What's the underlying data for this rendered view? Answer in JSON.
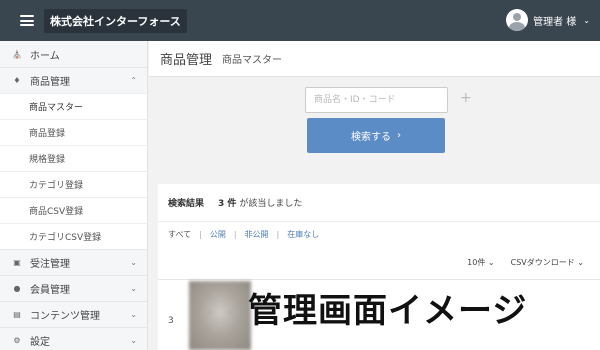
{
  "header": {
    "brand": "株式会社インターフォース",
    "user_label": "管理者 様"
  },
  "sidebar": {
    "items": [
      {
        "icon": "home-icon",
        "label": "ホーム"
      },
      {
        "icon": "tag-icon",
        "label": "商品管理",
        "expanded": true,
        "children": [
          "商品マスター",
          "商品登録",
          "規格登録",
          "カテゴリ登録",
          "商品CSV登録",
          "カテゴリCSV登録"
        ]
      },
      {
        "icon": "cart-icon",
        "label": "受注管理"
      },
      {
        "icon": "users-icon",
        "label": "会員管理"
      },
      {
        "icon": "document-icon",
        "label": "コンテンツ管理"
      },
      {
        "icon": "gear-icon",
        "label": "設定"
      }
    ]
  },
  "page": {
    "title": "商品管理",
    "subtitle": "商品マスター"
  },
  "search": {
    "placeholder": "商品名・ID・コード",
    "value": "",
    "button_label": "検索する"
  },
  "results": {
    "label": "検索結果",
    "count": "3 件",
    "message": "が該当しました",
    "filters": [
      "すべて",
      "公開",
      "非公開",
      "在庫なし"
    ],
    "per_page": "10件",
    "csv_download": "CSVダウンロード",
    "rows": [
      {
        "number": "3"
      }
    ]
  },
  "overlay_text": "管理画面イメージ",
  "colors": {
    "topbar": "#39454f",
    "accent_button": "#5b8cc6",
    "link": "#4f7fb8"
  }
}
